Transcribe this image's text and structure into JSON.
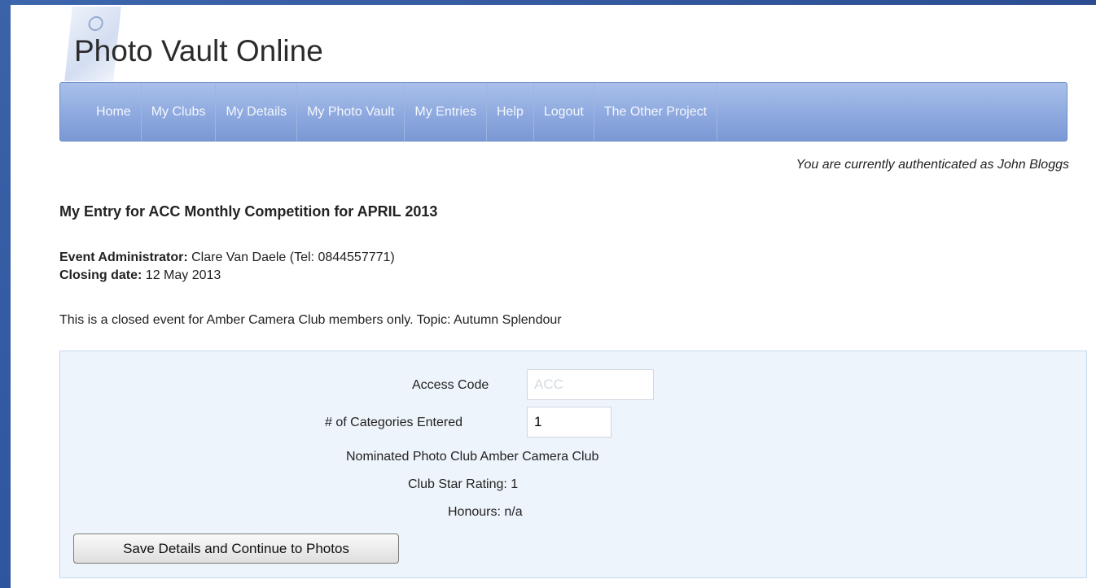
{
  "site": {
    "title": "Photo Vault Online"
  },
  "nav": {
    "items": [
      {
        "label": "Home"
      },
      {
        "label": "My Clubs"
      },
      {
        "label": "My Details"
      },
      {
        "label": "My Photo Vault"
      },
      {
        "label": "My Entries"
      },
      {
        "label": "Help"
      },
      {
        "label": "Logout"
      },
      {
        "label": "The Other Project"
      }
    ]
  },
  "auth": {
    "text": "You are currently authenticated as John Bloggs"
  },
  "entry": {
    "heading": "My Entry for ACC Monthly Competition for APRIL 2013",
    "admin_label": "Event Administrator:",
    "admin_value": "Clare Van Daele (Tel: 0844557771)",
    "closing_label": "Closing date:",
    "closing_value": "12 May 2013",
    "description": "This is a closed event for Amber Camera Club members only. Topic: Autumn Splendour"
  },
  "form": {
    "access_code_label": "Access Code",
    "access_code_value": "ACC",
    "categories_label": "# of Categories Entered",
    "categories_value": "1",
    "nominated_club_label": "Nominated Photo Club",
    "nominated_club_value": "Amber Camera Club",
    "star_rating_label": "Club Star Rating:",
    "star_rating_value": "1",
    "honours_label": "Honours:",
    "honours_value": "n/a",
    "save_button_label": "Save Details and Continue to Photos"
  }
}
